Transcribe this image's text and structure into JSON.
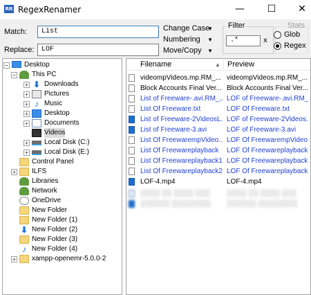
{
  "window": {
    "app_icon_text": "RR",
    "title": "RegexRenamer",
    "minimize_glyph": "—",
    "maximize_glyph": "☐",
    "close_glyph": "✕"
  },
  "toolbar": {
    "match_label": "Match:",
    "match_value": "List",
    "replace_label": "Replace:",
    "replace_value": "LOF",
    "menu": [
      {
        "label": "Change Case",
        "arrow": "▼"
      },
      {
        "label": "Numbering",
        "arrow": "▼"
      },
      {
        "label": "Move/Copy",
        "arrow": "▼"
      }
    ],
    "filter_title": "Filter",
    "filter_value": ".*",
    "filter_clear": "x",
    "stats_title": "Stats",
    "glob_label": "Glob",
    "regex_label": "Regex",
    "glob_selected": false,
    "regex_selected": true
  },
  "tree": {
    "nodes": [
      {
        "label": "Desktop",
        "icon": "monitor-icon"
      },
      {
        "label": "This PC",
        "icon": "person-icon"
      },
      {
        "label": "Downloads",
        "icon": "download-arrow-icon"
      },
      {
        "label": "Pictures",
        "icon": "pictures-folder-icon"
      },
      {
        "label": "Music",
        "icon": "music-note-icon"
      },
      {
        "label": "Desktop",
        "icon": "desktop-folder-icon"
      },
      {
        "label": "Documents",
        "icon": "documents-folder-icon"
      },
      {
        "label": "Videos",
        "icon": "videos-folder-icon",
        "selected": true
      },
      {
        "label": "Local Disk (C:)",
        "icon": "drive-icon"
      },
      {
        "label": "Local Disk (E:)",
        "icon": "drive-icon"
      },
      {
        "label": "Control Panel",
        "icon": "folder-icon"
      },
      {
        "label": "ILFS",
        "icon": "folder-icon"
      },
      {
        "label": "Libraries",
        "icon": "person-icon"
      },
      {
        "label": "Network",
        "icon": "person-icon"
      },
      {
        "label": "OneDrive",
        "icon": "onedrive-icon"
      },
      {
        "label": "New Folder",
        "icon": "folder-icon"
      },
      {
        "label": "New Folder (1)",
        "icon": "folder-icon"
      },
      {
        "label": "New Folder (2)",
        "icon": "download-arrow-icon"
      },
      {
        "label": "New Folder (3)",
        "icon": "folder-icon"
      },
      {
        "label": "New Folder (4)",
        "icon": "music-note-icon"
      },
      {
        "label": "xampp-openemr-5.0.0-2",
        "icon": "folder-icon"
      }
    ]
  },
  "files": {
    "columns": [
      "Filename",
      "Preview"
    ],
    "sort_arrow": "▲",
    "rows": [
      {
        "filename": "videompVideos.mp.RM_...",
        "preview": "videompVideos.mp.RM_...",
        "match": false,
        "icon": "file-icon"
      },
      {
        "filename": "Block Accounts Final Ver...",
        "preview": "Block Accounts Final Ver...",
        "match": false,
        "icon": "file-icon"
      },
      {
        "filename": "List of Freeware-.avi.RM_...",
        "preview": "LOF of Freeware-.avi.RM_...",
        "match": true,
        "icon": "file-icon"
      },
      {
        "filename": "List Of Freeware.txt",
        "preview": "LOF Of Freeware.txt",
        "match": true,
        "icon": "file-icon"
      },
      {
        "filename": "List of Freeware-2VideosL...",
        "preview": "LOF of Freeware-2Videos...",
        "match": true,
        "icon": "video-file-icon"
      },
      {
        "filename": "List of Freeware-3.avi",
        "preview": "LOF of Freeware-3.avi",
        "match": true,
        "icon": "video-file-icon"
      },
      {
        "filename": "List Of FreewarempVideo...",
        "preview": "LOF Of FreewarempVideo...",
        "match": true,
        "icon": "file-icon"
      },
      {
        "filename": "List Of Freewareplayback",
        "preview": "LOF Of Freewareplayback",
        "match": true,
        "icon": "file-icon"
      },
      {
        "filename": "List Of Freewareplayback1",
        "preview": "LOF Of Freewareplayback1",
        "match": true,
        "icon": "file-icon"
      },
      {
        "filename": "List Of Freewareplayback2",
        "preview": "LOF Of Freewareplayback2",
        "match": true,
        "icon": "file-icon"
      },
      {
        "filename": "LOF-4.mp4",
        "preview": "LOF-4.mp4",
        "match": false,
        "icon": "video-file-icon"
      }
    ]
  },
  "colors": {
    "match_text": "#1f3fd0",
    "selection": "#dcdcdc",
    "toolbar_bg": "#f0f0f0"
  }
}
